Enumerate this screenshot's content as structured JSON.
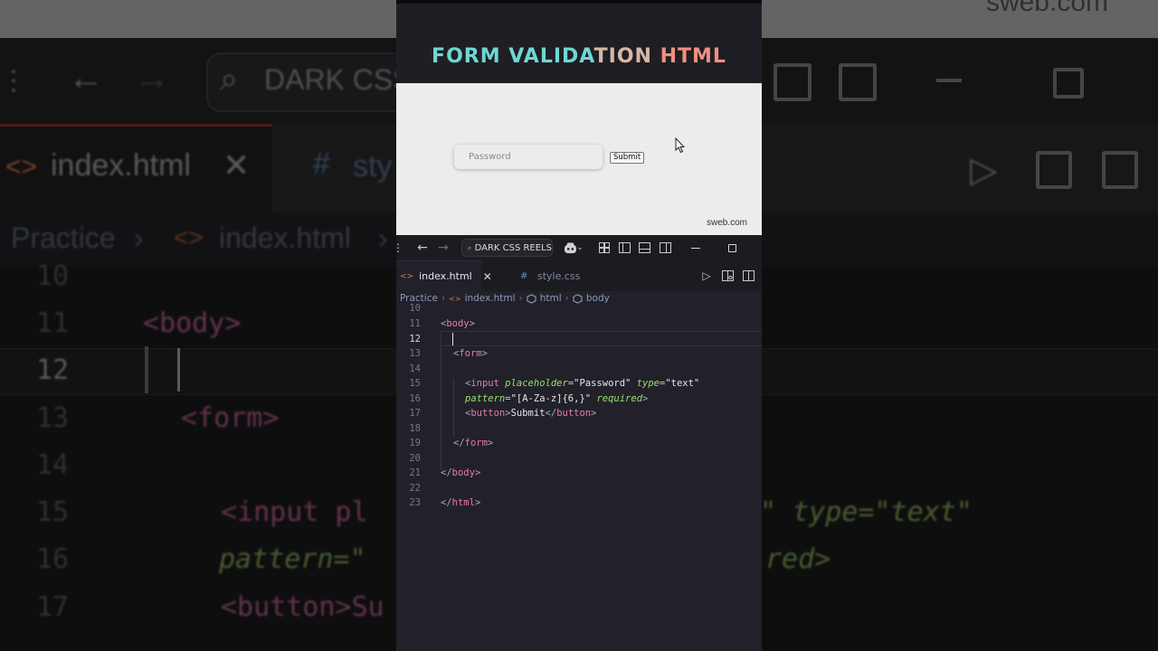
{
  "background": {
    "url_text": "sweb.com",
    "search_text": "DARK CSS",
    "tab_active": "index.html",
    "tab_inactive_glyph": "#",
    "tab_inactive_partial": "sty",
    "breadcrumb_root": "Practice",
    "breadcrumb_file": "index.html",
    "code": [
      {
        "n": "10",
        "text": ""
      },
      {
        "n": "11",
        "text": "<body>"
      },
      {
        "n": "12",
        "text": ""
      },
      {
        "n": "13",
        "text": "<form>"
      },
      {
        "n": "14",
        "text": ""
      },
      {
        "n": "15",
        "text": "<input pl",
        "tail": "\" type=\"text\""
      },
      {
        "n": "16",
        "text": "pattern=\"",
        "tail": "red>"
      },
      {
        "n": "17",
        "text": "<button>Su"
      }
    ]
  },
  "reel": {
    "title_part1": "FORM VALIDA",
    "title_part2": "TION",
    "title_part3": " HTML",
    "preview": {
      "input_placeholder": "Password",
      "button_label": "Submit",
      "watermark": "sweb.com"
    },
    "titlebar": {
      "search_label": "DARK CSS REELS"
    },
    "tabs": [
      {
        "label": "index.html",
        "active": true
      },
      {
        "label": "style.css",
        "active": false
      }
    ],
    "breadcrumb": [
      "Practice",
      "index.html",
      "html",
      "body"
    ],
    "editor": {
      "current_line": "12",
      "lines": [
        {
          "n": "10"
        },
        {
          "n": "11"
        },
        {
          "n": "12"
        },
        {
          "n": "13"
        },
        {
          "n": "14"
        },
        {
          "n": "15"
        },
        {
          "n": "16"
        },
        {
          "n": "17"
        },
        {
          "n": "18"
        },
        {
          "n": "19"
        },
        {
          "n": "20"
        },
        {
          "n": "21"
        },
        {
          "n": "22"
        },
        {
          "n": "23"
        }
      ],
      "code_text": {
        "l11": [
          "<",
          "body",
          ">"
        ],
        "l13": [
          "<",
          "form",
          ">"
        ],
        "l15": [
          "<",
          "input",
          " ",
          "placeholder",
          "=",
          "\"Password\"",
          " ",
          "type",
          "=",
          "\"text\""
        ],
        "l16": [
          "pattern",
          "=",
          "\"[A-Za-z]{6,}\"",
          " ",
          "required",
          ">"
        ],
        "l17": [
          "<",
          "button",
          ">",
          "Submit",
          "</",
          "button",
          ">"
        ],
        "l19": [
          "</",
          "form",
          ">"
        ],
        "l21": [
          "</",
          "body",
          ">"
        ],
        "l23": [
          "</",
          "html",
          ">"
        ]
      }
    }
  }
}
